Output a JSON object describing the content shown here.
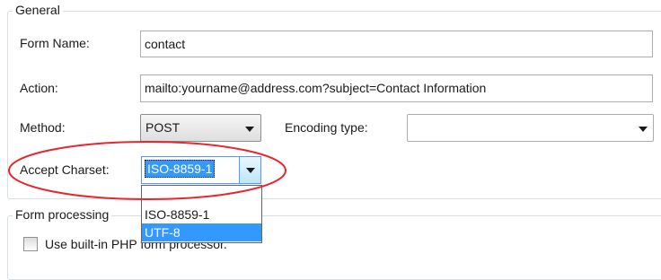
{
  "general": {
    "title": "General",
    "form_name": {
      "label": "Form Name:",
      "value": "contact"
    },
    "action": {
      "label": "Action:",
      "value": "mailto:yourname@address.com?subject=Contact Information"
    },
    "method": {
      "label": "Method:",
      "value": "POST"
    },
    "encoding": {
      "label": "Encoding type:",
      "value": ""
    },
    "charset": {
      "label": "Accept Charset:",
      "value": "ISO-8859-1",
      "options": [
        "ISO-8859-1",
        "UTF-8"
      ],
      "highlighted_option": "UTF-8"
    }
  },
  "processing": {
    "title": "Form processing",
    "builtin_checkbox": {
      "label": "Use built-in PHP form processor.",
      "checked": false
    }
  },
  "annotation": {
    "color": "#e8262e",
    "shape": "ellipse"
  }
}
